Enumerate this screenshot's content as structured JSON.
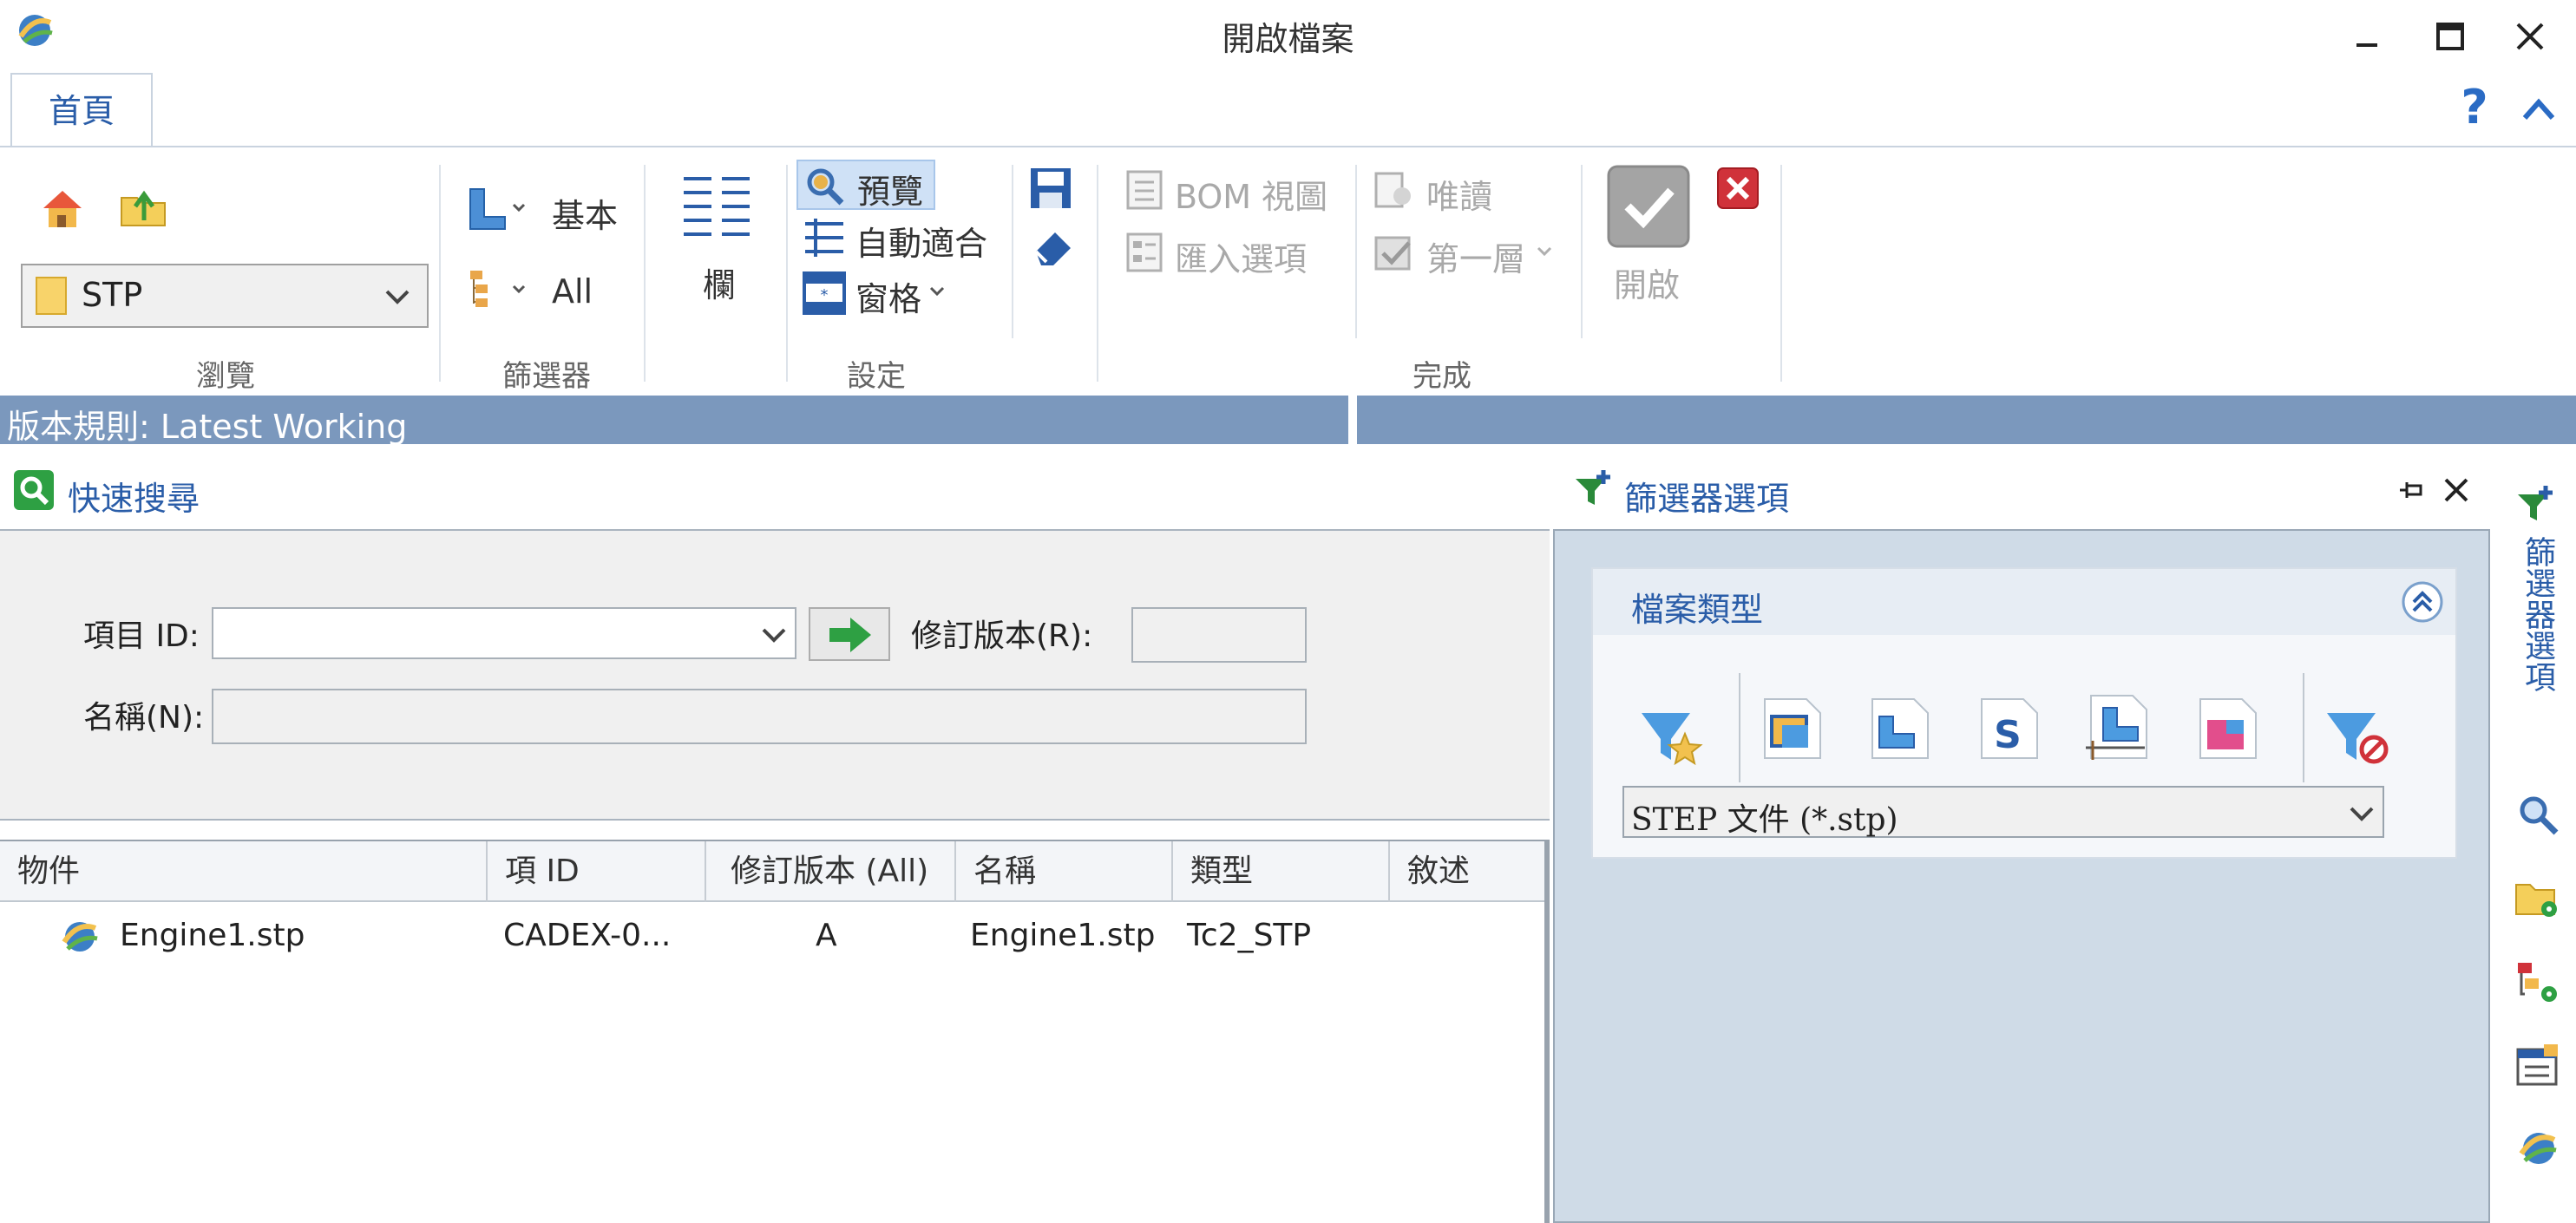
{
  "window": {
    "title": "開啟檔案"
  },
  "tabs": [
    {
      "label": "首頁"
    }
  ],
  "ribbon": {
    "browse": {
      "group_label": "瀏覽",
      "folder_value": "STP"
    },
    "filter": {
      "group_label": "篩選器",
      "basic_label": "基本",
      "all_label": "All"
    },
    "columns": {
      "label": "欄"
    },
    "settings": {
      "group_label": "設定",
      "preview_label": "預覽",
      "autofit_label": "自動適合",
      "pane_label": "窗格"
    },
    "done": {
      "group_label": "完成",
      "bom_view_label": "BOM 視圖",
      "import_options_label": "匯入選項",
      "readonly_label": "唯讀",
      "first_level_label": "第一層",
      "open_label": "開啟"
    }
  },
  "version_rule": {
    "text": "版本規則: Latest Working"
  },
  "quick_search": {
    "title": "快速搜尋",
    "item_id_label": "項目 ID:",
    "item_id_value": "",
    "revision_label": "修訂版本(R):",
    "revision_value": "",
    "name_label": "名稱(N):",
    "name_value": ""
  },
  "table": {
    "columns": [
      "物件",
      "項 ID",
      "修訂版本 (All)",
      "名稱",
      "類型",
      "敘述"
    ],
    "rows": [
      {
        "object": "Engine1.stp",
        "item_id": "CADEX-0...",
        "revision": "A",
        "name": "Engine1.stp",
        "type": "Tc2_STP",
        "description": ""
      }
    ]
  },
  "filter_options": {
    "title": "篩選器選項",
    "file_type_header": "檔案類型",
    "file_type_value": "STEP 文件 (*.stp)",
    "side_tab_label": "篩選器選項"
  },
  "colors": {
    "accent_blue": "#2a5da8",
    "version_bar": "#7b98bd",
    "filter_panel_bg": "#cfdbe7",
    "go_green": "#2ea043",
    "close_red": "#d0323a"
  },
  "icons": [
    "app-icon",
    "minimize-icon",
    "maximize-icon",
    "close-icon",
    "help-icon",
    "collapse-ribbon-icon",
    "home-icon",
    "folder-up-icon",
    "folder-icon",
    "basic-filter-icon",
    "tree-filter-icon",
    "columns-icon",
    "preview-icon",
    "autofit-icon",
    "pane-icon",
    "save-icon",
    "eraser-icon",
    "bom-view-icon",
    "import-options-icon",
    "readonly-icon",
    "first-level-icon",
    "open-check-icon",
    "cancel-red-icon",
    "search-green-icon",
    "go-arrow-icon",
    "funnel-pin-icon",
    "pin-icon",
    "panel-close-icon",
    "collapse-up-icon",
    "favorite-filter-icon",
    "assembly-icon",
    "part-icon",
    "sheet-icon",
    "drawing-icon",
    "model-icon",
    "clear-filter-icon",
    "search-icon",
    "folder-gear-icon",
    "tree-gear-icon",
    "properties-icon",
    "stp-file-icon"
  ]
}
